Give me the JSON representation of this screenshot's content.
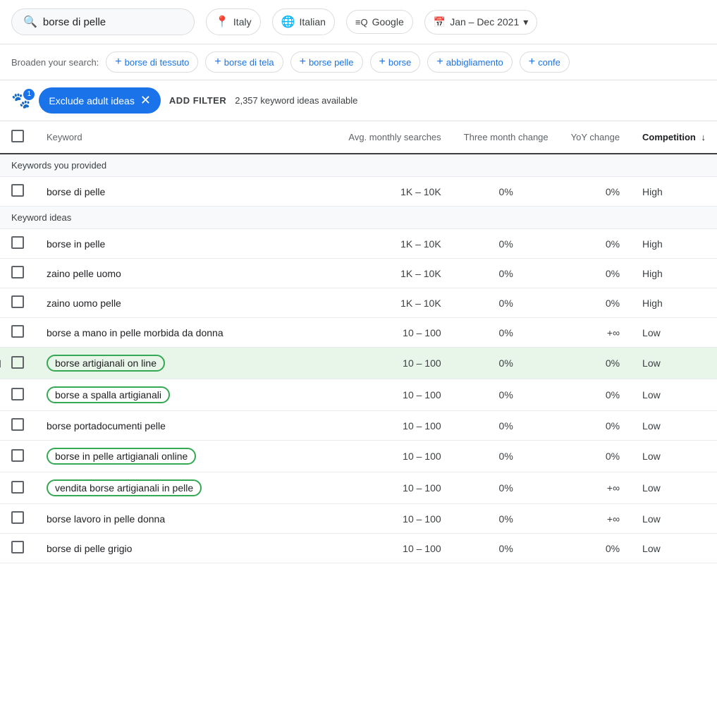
{
  "header": {
    "search_value": "borse di pelle",
    "search_icon": "🔍",
    "location": "Italy",
    "location_icon": "📍",
    "language": "Italian",
    "language_icon": "🌐",
    "source": "Google",
    "source_icon": "≡Q",
    "date_range": "Jan – Dec 2021",
    "date_icon": "📅",
    "chevron": "▾"
  },
  "broaden": {
    "label": "Broaden your search:",
    "chips": [
      "borse di tessuto",
      "borse di tela",
      "borse pelle",
      "borse",
      "abbigliamento",
      "confe"
    ]
  },
  "filter_bar": {
    "badge": "1",
    "exclude_btn": "Exclude adult ideas",
    "add_filter": "ADD FILTER",
    "available_count": "2,357 keyword ideas available"
  },
  "table": {
    "columns": {
      "keyword": "Keyword",
      "avg_monthly": "Avg. monthly searches",
      "three_month": "Three month change",
      "yoy": "YoY change",
      "competition": "Competition"
    },
    "sections": [
      {
        "section_title": "Keywords you provided",
        "rows": [
          {
            "keyword": "borse di pelle",
            "highlighted": false,
            "avg_monthly": "1K – 10K",
            "three_month": "0%",
            "yoy": "0%",
            "competition": "High"
          }
        ]
      },
      {
        "section_title": "Keyword ideas",
        "rows": [
          {
            "keyword": "borse in pelle",
            "highlighted": false,
            "avg_monthly": "1K – 10K",
            "three_month": "0%",
            "yoy": "0%",
            "competition": "High"
          },
          {
            "keyword": "zaino pelle uomo",
            "highlighted": false,
            "avg_monthly": "1K – 10K",
            "three_month": "0%",
            "yoy": "0%",
            "competition": "High"
          },
          {
            "keyword": "zaino uomo pelle",
            "highlighted": false,
            "avg_monthly": "1K – 10K",
            "three_month": "0%",
            "yoy": "0%",
            "competition": "High"
          },
          {
            "keyword": "borse a mano in pelle morbida da donna",
            "highlighted": false,
            "avg_monthly": "10 – 100",
            "three_month": "0%",
            "yoy": "+∞",
            "competition": "Low"
          },
          {
            "keyword": "borse artigianali on line",
            "highlighted": true,
            "is_active_row": true,
            "avg_monthly": "10 – 100",
            "three_month": "0%",
            "yoy": "0%",
            "competition": "Low"
          },
          {
            "keyword": "borse a spalla artigianali",
            "highlighted": true,
            "avg_monthly": "10 – 100",
            "three_month": "0%",
            "yoy": "0%",
            "competition": "Low"
          },
          {
            "keyword": "borse portadocumenti pelle",
            "highlighted": false,
            "avg_monthly": "10 – 100",
            "three_month": "0%",
            "yoy": "0%",
            "competition": "Low"
          },
          {
            "keyword": "borse in pelle artigianali online",
            "highlighted": true,
            "avg_monthly": "10 – 100",
            "three_month": "0%",
            "yoy": "0%",
            "competition": "Low"
          },
          {
            "keyword": "vendita borse artigianali in pelle",
            "highlighted": true,
            "avg_monthly": "10 – 100",
            "three_month": "0%",
            "yoy": "+∞",
            "competition": "Low"
          },
          {
            "keyword": "borse lavoro in pelle donna",
            "highlighted": false,
            "avg_monthly": "10 – 100",
            "three_month": "0%",
            "yoy": "+∞",
            "competition": "Low"
          },
          {
            "keyword": "borse di pelle grigio",
            "highlighted": false,
            "avg_monthly": "10 – 100",
            "three_month": "0%",
            "yoy": "0%",
            "competition": "Low"
          }
        ]
      }
    ]
  }
}
